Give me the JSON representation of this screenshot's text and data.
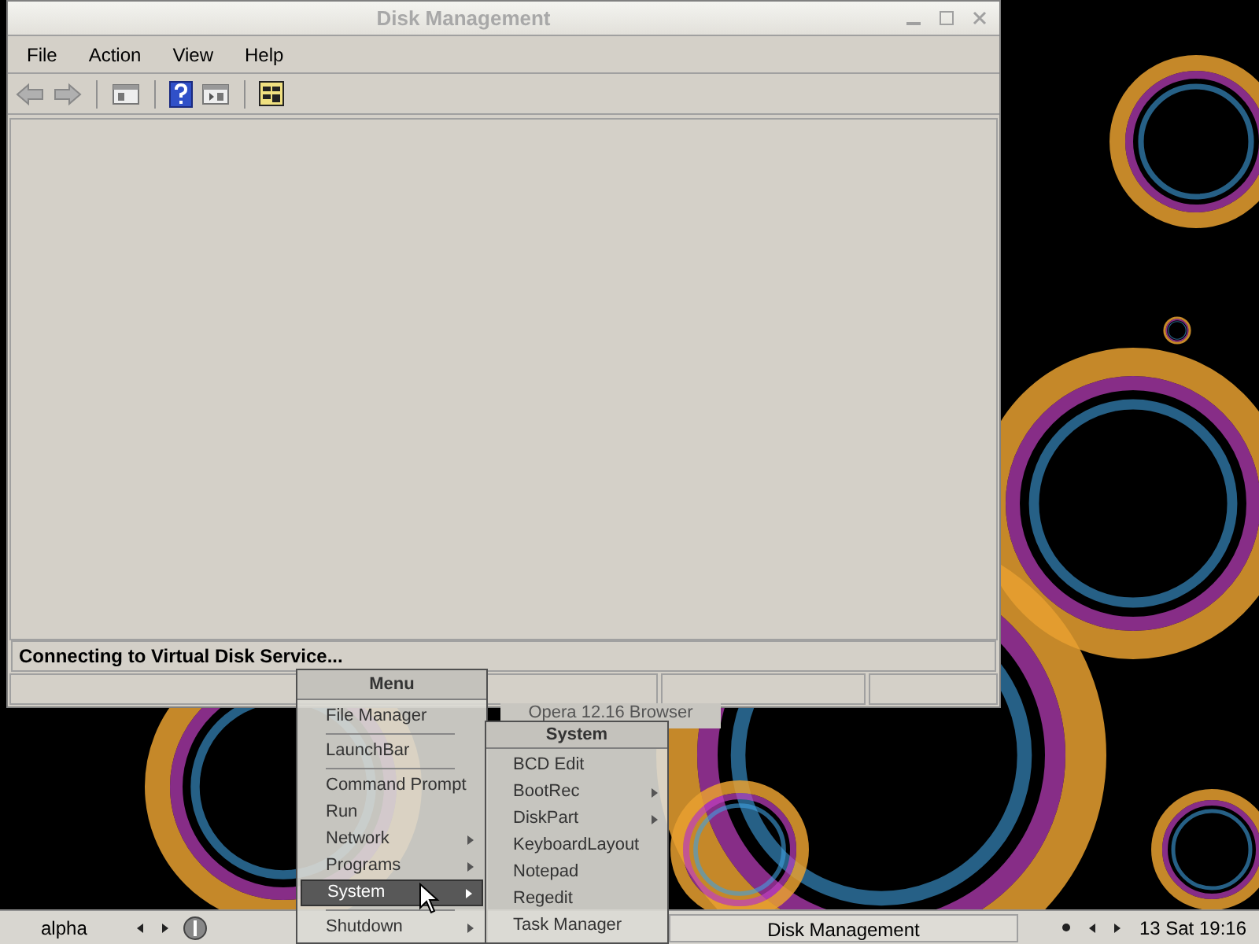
{
  "window": {
    "title": "Disk Management",
    "menu_bar": [
      "File",
      "Action",
      "View",
      "Help"
    ],
    "status_text": "Connecting to Virtual Disk Service..."
  },
  "background_window": {
    "title": "Opera 12.16 Browser"
  },
  "start_menu": {
    "title": "Menu",
    "items": [
      {
        "kind": "entry",
        "label": "File Manager",
        "has_submenu": false,
        "selected": false
      },
      {
        "kind": "separator"
      },
      {
        "kind": "entry",
        "label": "LaunchBar",
        "has_submenu": false,
        "selected": false
      },
      {
        "kind": "separator"
      },
      {
        "kind": "entry",
        "label": "Command Prompt",
        "has_submenu": false,
        "selected": false
      },
      {
        "kind": "entry",
        "label": "Run",
        "has_submenu": false,
        "selected": false
      },
      {
        "kind": "entry",
        "label": "Network",
        "has_submenu": true,
        "selected": false
      },
      {
        "kind": "entry",
        "label": "Programs",
        "has_submenu": true,
        "selected": false
      },
      {
        "kind": "entry",
        "label": "System",
        "has_submenu": true,
        "selected": true
      },
      {
        "kind": "separator"
      },
      {
        "kind": "entry",
        "label": "Shutdown",
        "has_submenu": true,
        "selected": false
      }
    ]
  },
  "submenu": {
    "title": "System",
    "items": [
      {
        "label": "BCD Edit",
        "has_submenu": false
      },
      {
        "label": "BootRec",
        "has_submenu": true
      },
      {
        "label": "DiskPart",
        "has_submenu": true
      },
      {
        "label": "KeyboardLayout",
        "has_submenu": false
      },
      {
        "label": "Notepad",
        "has_submenu": false
      },
      {
        "label": "Regedit",
        "has_submenu": false
      },
      {
        "label": "Task Manager",
        "has_submenu": false
      }
    ]
  },
  "taskbar": {
    "workspace": "alpha",
    "tasks": [
      "Disk Management"
    ],
    "clock": "13 Sat 19:16"
  }
}
